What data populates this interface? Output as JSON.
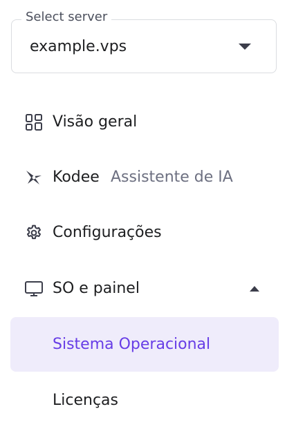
{
  "server_select": {
    "label": "Select server",
    "value": "example.vps"
  },
  "menu": {
    "overview": {
      "label": "Visão geral",
      "icon": "grid-icon"
    },
    "kodee": {
      "label": "Kodee",
      "sublabel": "Assistente de IA",
      "icon": "kodee-star-icon"
    },
    "settings": {
      "label": "Configurações",
      "icon": "gear-icon"
    },
    "os_panel": {
      "label": "SO e painel",
      "icon": "monitor-icon",
      "expanded": true,
      "children": [
        {
          "label": "Sistema Operacional",
          "active": true
        },
        {
          "label": "Licenças",
          "active": false
        }
      ]
    }
  },
  "colors": {
    "accent": "#673de6",
    "active_bg": "#efecfb",
    "text": "#1d1e20",
    "muted": "#6d7081",
    "border": "#dadce0"
  }
}
